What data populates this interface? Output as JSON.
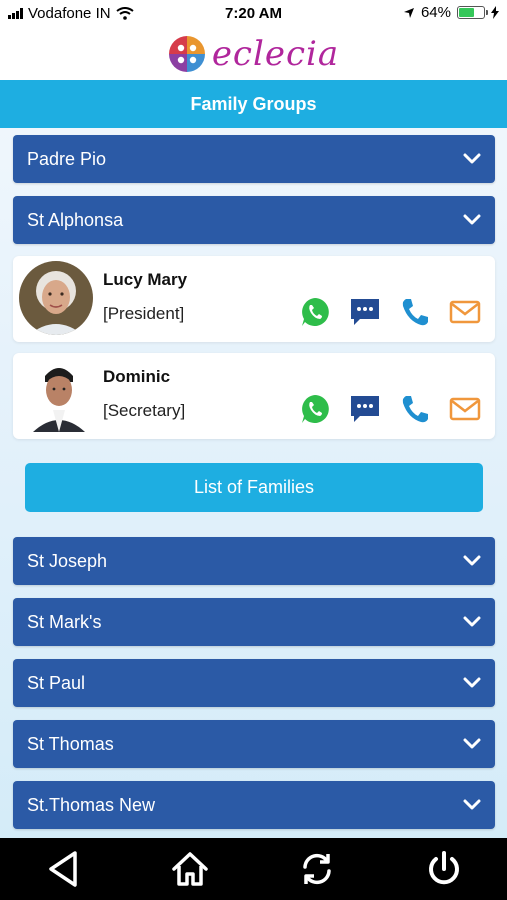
{
  "status": {
    "carrier": "Vodafone IN",
    "time": "7:20 AM",
    "battery": "64%",
    "battery_level": 0.64,
    "battery_color": "#35c759"
  },
  "app": {
    "logo_text": "eclecia",
    "brand_color": "#b0269c",
    "icon": "eclecia-logo-icon"
  },
  "header": {
    "title": "Family Groups",
    "color": "#1eaee1"
  },
  "groups_top": [
    {
      "label": "Padre Pio",
      "icon": "chevron-down-icon"
    },
    {
      "label": "St Alphonsa",
      "icon": "chevron-down-icon"
    }
  ],
  "contacts": [
    {
      "name": "Lucy Mary",
      "role": "[President]"
    },
    {
      "name": "Dominic",
      "role": "[Secretary]"
    }
  ],
  "contact_actions": [
    "whatsapp-icon",
    "message-icon",
    "phone-icon",
    "email-icon"
  ],
  "list_button": {
    "label": "List of Families"
  },
  "groups_bottom": [
    {
      "label": "St Joseph",
      "icon": "chevron-down-icon"
    },
    {
      "label": "St Mark's",
      "icon": "chevron-down-icon"
    },
    {
      "label": "St Paul",
      "icon": "chevron-down-icon"
    },
    {
      "label": "St Thomas",
      "icon": "chevron-down-icon"
    },
    {
      "label": "St.Thomas New",
      "icon": "chevron-down-icon"
    }
  ],
  "accordion_color": "#2b5aa6",
  "nav": [
    "back-icon",
    "home-icon",
    "refresh-icon",
    "power-icon"
  ]
}
